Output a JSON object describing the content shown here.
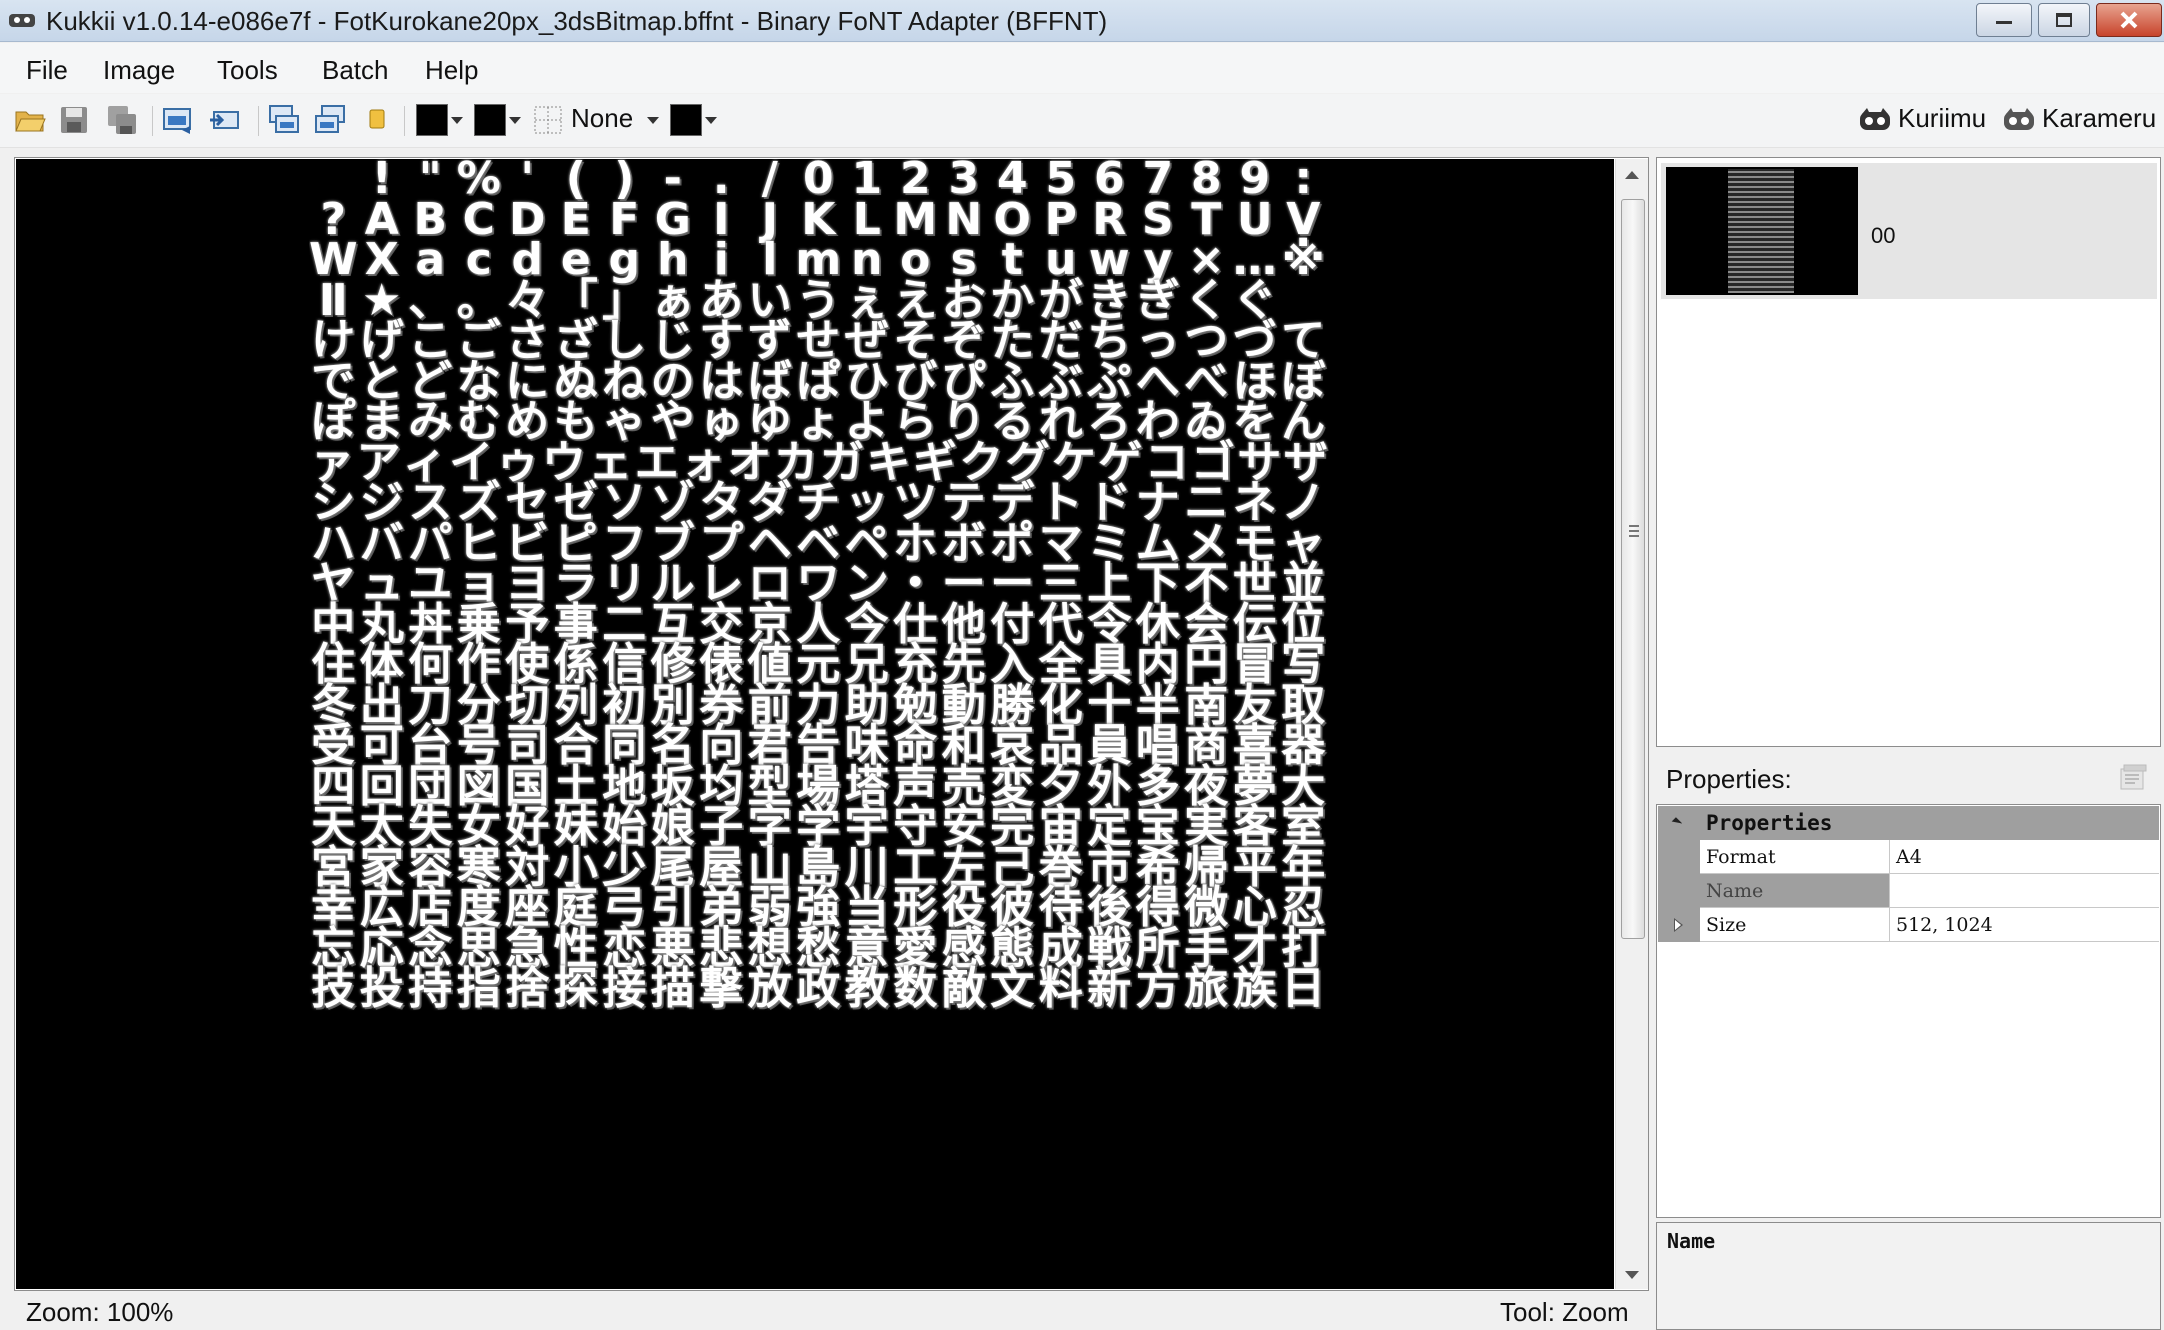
{
  "window": {
    "title": "Kukkii v1.0.14-e086e7f - FotKurokane20px_3dsBitmap.bffnt - Binary FoNT Adapter (BFFNT)"
  },
  "menu": {
    "items": [
      "File",
      "Image",
      "Tools",
      "Batch",
      "Help"
    ]
  },
  "toolbar": {
    "border_mode_label": "None",
    "kuriimu_label": "Kuriimu",
    "karameru_label": "Karameru",
    "colors": {
      "primary": "#000000",
      "secondary": "#000000",
      "border": "#000000"
    }
  },
  "canvas": {
    "glyph_rows": [
      " !\"%'()-./0123456789:",
      "?ABCDEFGIJKLMNOPRSTUV",
      "WXacdeghilmnostuwy×…※",
      "Ⅱ★、。々「」ぁあいうぇえおかがきぎくぐ",
      "けげこごさざしじすずせぜそぞただちっつづて",
      "でとどなにぬねのはばぱひびぴふぶぷへべほぼ",
      "ぽまみむめもゃやゅゆょよらりるれろわゐをん",
      "ァアィイゥウェエォオカガキギクグケゲコゴサザ",
      "シジスズセゼソゾタダチッツテデトドナニネノ",
      "ハバパヒビピフブプヘベペホボポマミムメモャ",
      "ヤュユョヨラリルレロワン・ーー三上下不世並",
      "中丸丼乗予事二互交京人今仕他付代令休会伝位",
      "住体何作使係信修俵値元兄充先入全具内円冒写",
      "冬出刀分切列初別券前力助勉動勝化十半南友取",
      "受可台号司合同名向君告味命和哀品員唱商喜器",
      "四回団図国土地坂均型場塔声売変夕外多夜夢大",
      "天太失女好妹始娘子字学宇守安完宙定宝実客室",
      "宮家容寒対小少尾屋山島川工左己巻市希帰平年",
      "幸広店度座庭弓引弟弱強当形役彼待後得微心忍",
      "忘応念思急性恋悪悲想愁意愛感態成戦所手才打",
      "技投持指捨探接描撃放政教数敵文料新方旅族日"
    ]
  },
  "status": {
    "zoom": "Zoom: 100%",
    "tool": "Tool: Zoom"
  },
  "image_list": {
    "items": [
      {
        "label": "00"
      }
    ]
  },
  "properties": {
    "header": "Properties:",
    "category": "Properties",
    "rows": [
      {
        "name": "Format",
        "value": "A4"
      },
      {
        "name": "Name",
        "value": ""
      },
      {
        "name": "Size",
        "value": "512, 1024"
      }
    ]
  },
  "description": {
    "title": "Name"
  }
}
